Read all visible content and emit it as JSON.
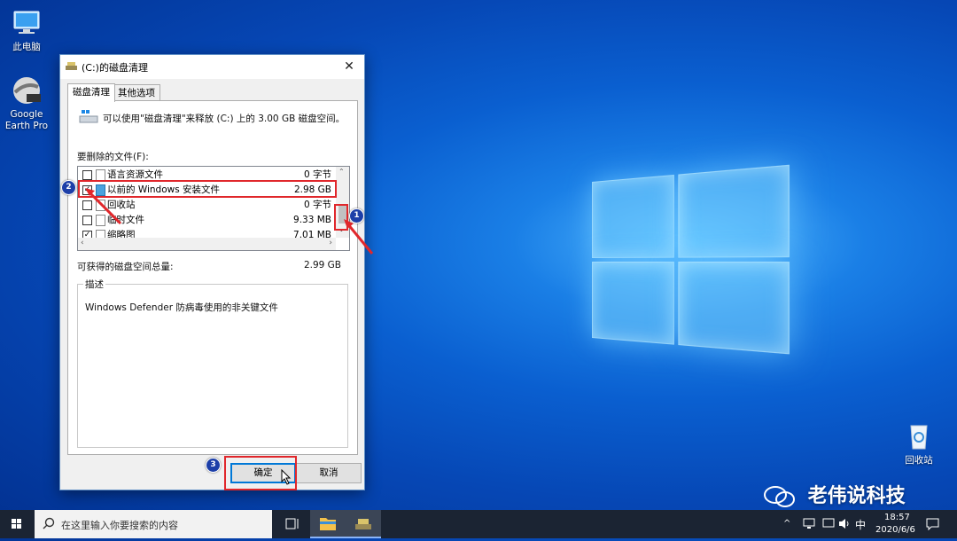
{
  "desktop": {
    "icons": [
      {
        "label": "此电脑"
      },
      {
        "label": "Google Earth Pro"
      },
      {
        "label": "回收站"
      }
    ],
    "watermark": "老伟说科技"
  },
  "dialog": {
    "title": "(C:)的磁盘清理",
    "close_label": "✕",
    "tabs": [
      {
        "label": "磁盘清理",
        "active": true
      },
      {
        "label": "其他选项",
        "active": false
      }
    ],
    "intro_text": "可以使用\"磁盘清理\"来释放 (C:) 上的 3.00 GB 磁盘空间。",
    "files_label": "要删除的文件(F):",
    "files": [
      {
        "name": "语言资源文件",
        "size": "0 字节",
        "checked": false
      },
      {
        "name": "以前的 Windows 安装文件",
        "size": "2.98 GB",
        "checked": true
      },
      {
        "name": "回收站",
        "size": "0 字节",
        "checked": false
      },
      {
        "name": "临时文件",
        "size": "9.33 MB",
        "checked": false
      },
      {
        "name": "缩略图",
        "size": "7.01 MB",
        "checked": true
      }
    ],
    "total_label": "可获得的磁盘空间总量:",
    "total_value": "2.99 GB",
    "description_legend": "描述",
    "description_text": "Windows Defender 防病毒使用的非关键文件",
    "ok_label": "确定",
    "cancel_label": "取消"
  },
  "annotations": [
    {
      "label": "1"
    },
    {
      "label": "2"
    },
    {
      "label": "3"
    }
  ],
  "taskbar": {
    "search_placeholder": "在这里输入你要搜索的内容",
    "ime": "中",
    "time": "18:57",
    "date": "2020/6/6"
  },
  "colors": {
    "accent": "#0078d7",
    "annotation_red": "#e0272b",
    "badge_blue": "#1d3fa8"
  }
}
